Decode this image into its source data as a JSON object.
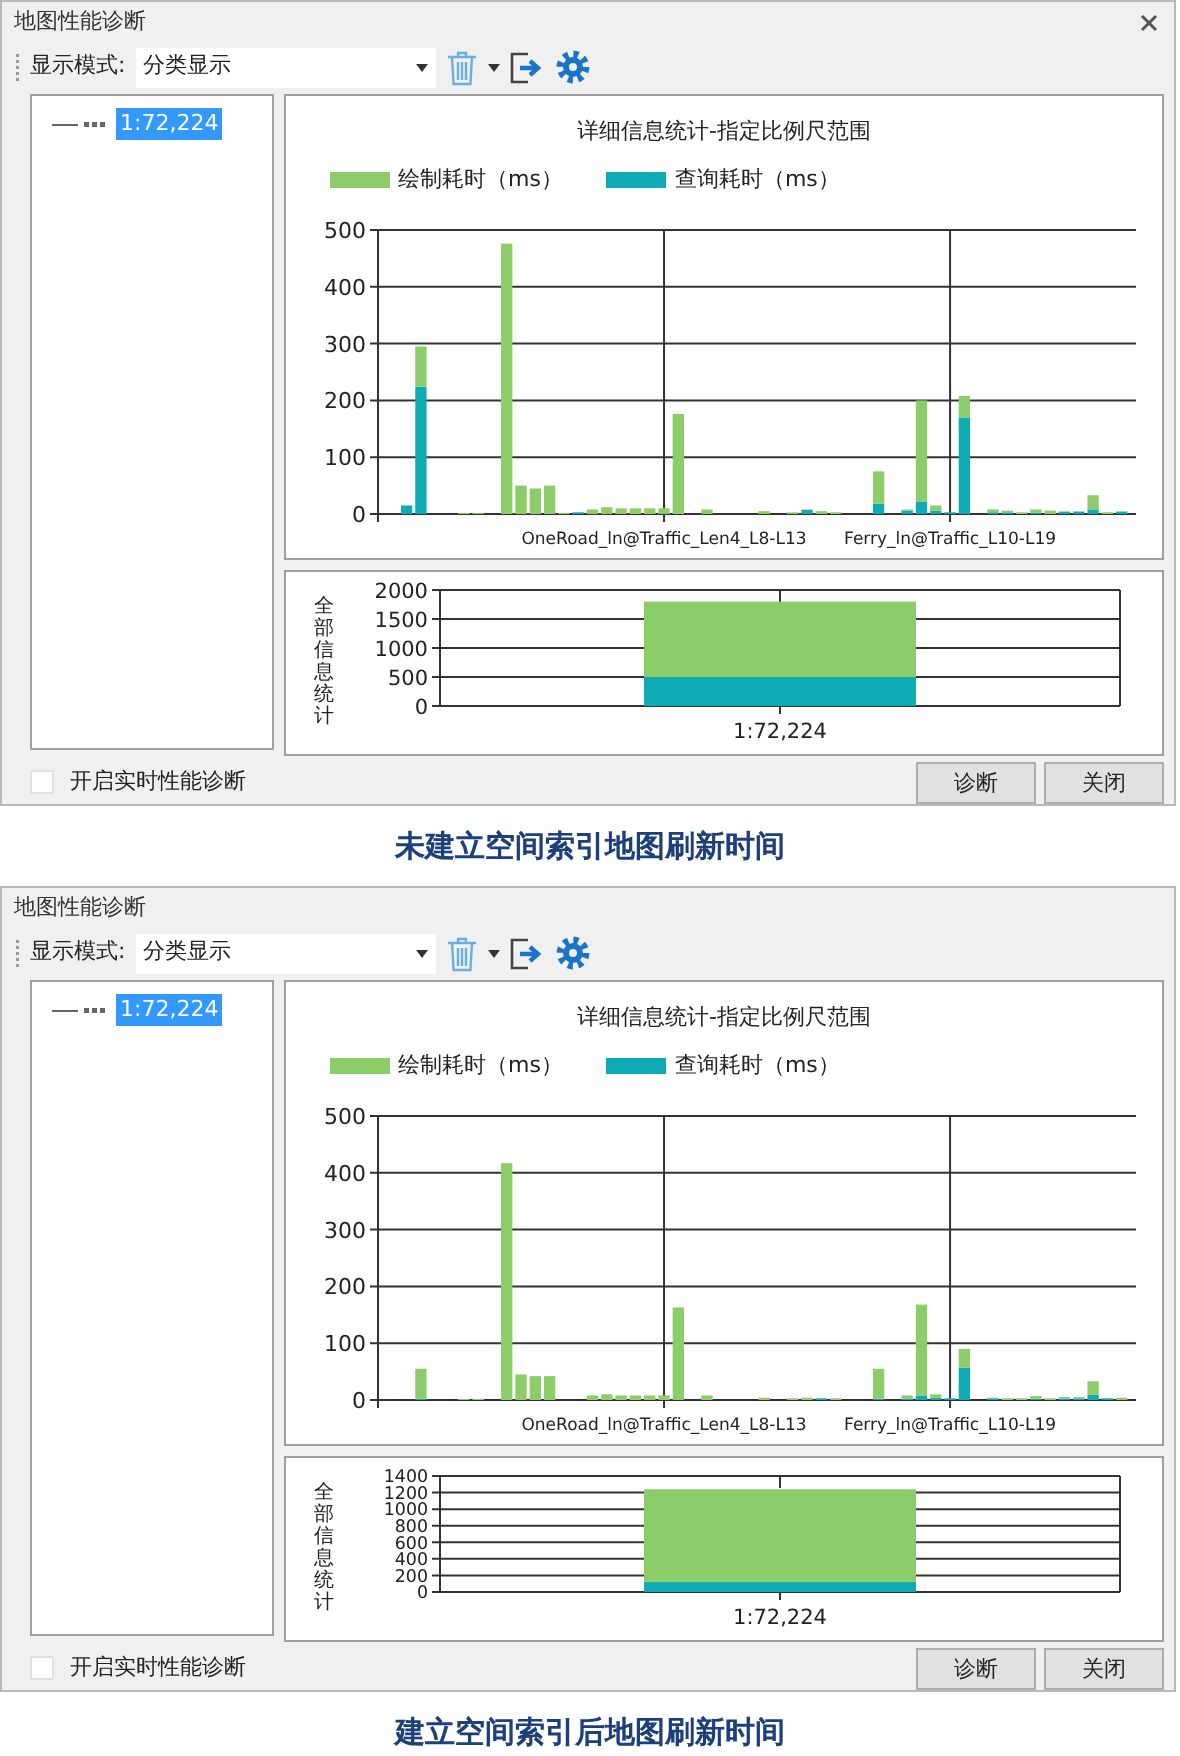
{
  "panels": [
    {
      "window": {
        "title": "地图性能诊断",
        "close_icon": true
      },
      "toolbar": {
        "mode_label": "显示模式:",
        "mode_value": "分类显示"
      },
      "tree": [
        {
          "label": "1:72,224",
          "selected": true
        }
      ],
      "detail_chart": {
        "chart_data": {
          "type": "bar",
          "title": "详细信息统计-指定比例尺范围",
          "legend": "top",
          "stacked": true,
          "grid": true,
          "ylim": [
            0,
            500
          ],
          "yticks": [
            0,
            100,
            200,
            300,
            400,
            500
          ],
          "categories": [
            null,
            null,
            null,
            null,
            null,
            null,
            null,
            null,
            null,
            null,
            null,
            null,
            null,
            null,
            null,
            null,
            null,
            null,
            null,
            "OneRoad_ln@Traffic_Len4_L8-L13",
            null,
            null,
            null,
            null,
            null,
            null,
            null,
            null,
            null,
            null,
            null,
            null,
            null,
            null,
            null,
            null,
            null,
            null,
            null,
            "Ferry_ln@Traffic_L10-L19",
            null,
            null,
            null,
            null,
            null,
            null,
            null,
            null,
            null,
            null,
            null,
            null
          ],
          "series": [
            {
              "name": "查询耗时（ms）",
              "color": "#0eabb5",
              "values": [
                0,
                15,
                224,
                0,
                0,
                0,
                0,
                0,
                0,
                0,
                0,
                0,
                0,
                3,
                0,
                0,
                0,
                0,
                0,
                0,
                0,
                0,
                0,
                0,
                0,
                0,
                0,
                0,
                0,
                7,
                0,
                0,
                0,
                0,
                18,
                0,
                6,
                22,
                6,
                3,
                170,
                0,
                3,
                3,
                0,
                2,
                0,
                4,
                4,
                8,
                0,
                4
              ]
            },
            {
              "name": "绘制耗时（ms）",
              "color": "#8ccd69",
              "values": [
                0,
                0,
                71,
                0,
                0,
                2,
                2,
                0,
                476,
                50,
                45,
                50,
                2,
                0,
                8,
                12,
                10,
                10,
                10,
                10,
                176,
                0,
                8,
                0,
                0,
                0,
                5,
                0,
                3,
                1,
                5,
                3,
                0,
                0,
                57,
                0,
                2,
                178,
                9,
                0,
                38,
                0,
                5,
                3,
                3,
                6,
                6,
                1,
                1,
                25,
                3,
                1
              ]
            }
          ]
        }
      },
      "summary_chart": {
        "chart_data": {
          "type": "bar",
          "ylabel": "全部信息统计",
          "stacked": true,
          "grid": true,
          "categories": [
            "1:72,224"
          ],
          "ylim": [
            0,
            2000
          ],
          "yticks": [
            0,
            500,
            1000,
            1500,
            2000
          ],
          "series": [
            {
              "color": "#0eabb5",
              "values": [
                500
              ]
            },
            {
              "color": "#8ccd69",
              "values": [
                1300
              ]
            }
          ]
        }
      },
      "realtime_checkbox": {
        "label": "开启实时性能诊断",
        "checked": false
      },
      "buttons": [
        "诊断",
        "关闭"
      ],
      "caption": "未建立空间索引地图刷新时间"
    },
    {
      "window": {
        "title": "地图性能诊断",
        "close_icon": false
      },
      "toolbar": {
        "mode_label": "显示模式:",
        "mode_value": "分类显示"
      },
      "tree": [
        {
          "label": "1:72,224",
          "selected": true
        }
      ],
      "detail_chart": {
        "chart_data": {
          "type": "bar",
          "title": "详细信息统计-指定比例尺范围",
          "legend": "top",
          "stacked": true,
          "grid": true,
          "ylim": [
            0,
            500
          ],
          "yticks": [
            0,
            100,
            200,
            300,
            400,
            500
          ],
          "categories": [
            null,
            null,
            null,
            null,
            null,
            null,
            null,
            null,
            null,
            null,
            null,
            null,
            null,
            null,
            null,
            null,
            null,
            null,
            null,
            "OneRoad_ln@Traffic_Len4_L8-L13",
            null,
            null,
            null,
            null,
            null,
            null,
            null,
            null,
            null,
            null,
            null,
            null,
            null,
            null,
            null,
            null,
            null,
            null,
            null,
            "Ferry_ln@Traffic_L10-L19",
            null,
            null,
            null,
            null,
            null,
            null,
            null,
            null,
            null,
            null,
            null,
            null
          ],
          "series": [
            {
              "name": "查询耗时（ms）",
              "color": "#0eabb5",
              "values": [
                0,
                0,
                2,
                0,
                0,
                0,
                0,
                0,
                0,
                0,
                0,
                0,
                0,
                0,
                0,
                0,
                0,
                0,
                0,
                0,
                0,
                0,
                0,
                0,
                0,
                0,
                0,
                0,
                0,
                0,
                3,
                0,
                0,
                0,
                2,
                0,
                2,
                8,
                4,
                3,
                57,
                0,
                3,
                0,
                0,
                2,
                0,
                3,
                3,
                9,
                3,
                0
              ]
            },
            {
              "name": "绘制耗时（ms）",
              "color": "#8ccd69",
              "values": [
                0,
                0,
                53,
                0,
                0,
                2,
                2,
                0,
                417,
                45,
                42,
                42,
                0,
                0,
                8,
                10,
                8,
                8,
                8,
                8,
                163,
                0,
                8,
                0,
                0,
                0,
                4,
                0,
                3,
                4,
                0,
                3,
                0,
                0,
                53,
                0,
                6,
                160,
                6,
                0,
                33,
                0,
                1,
                3,
                3,
                5,
                3,
                2,
                2,
                24,
                0,
                4
              ]
            }
          ]
        }
      },
      "summary_chart": {
        "chart_data": {
          "type": "bar",
          "ylabel": "全部信息统计",
          "stacked": true,
          "grid": true,
          "categories": [
            "1:72,224"
          ],
          "ylim": [
            0,
            1400
          ],
          "yticks": [
            0,
            200,
            400,
            600,
            800,
            1000,
            1200,
            1400
          ],
          "series": [
            {
              "color": "#0eabb5",
              "values": [
                120
              ]
            },
            {
              "color": "#8ccd69",
              "values": [
                1120
              ]
            }
          ]
        }
      },
      "realtime_checkbox": {
        "label": "开启实时性能诊断",
        "checked": false
      },
      "buttons": [
        "诊断",
        "关闭"
      ],
      "caption": "建立空间索引后地图刷新时间"
    }
  ]
}
